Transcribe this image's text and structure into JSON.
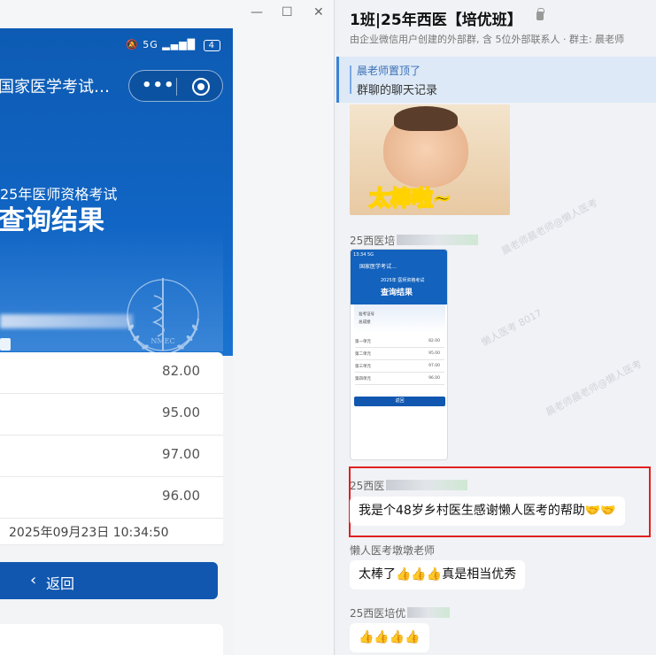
{
  "window": {
    "minimize_glyph": "—",
    "maximize_glyph": "☐",
    "close_glyph": "✕"
  },
  "phone": {
    "status_network": "5G",
    "status_signal": "▂▄▆█",
    "status_battery": "4",
    "app_title": "国家医学考试…",
    "hero_subtitle": "25年医师资格考试",
    "hero_title": "查询结果",
    "scores": [
      "82.00",
      "95.00",
      "97.00",
      "96.00"
    ],
    "query_time": "2025年09月23日 10:34:50",
    "back_label": "返回",
    "emblem_text": "NMEC"
  },
  "chat": {
    "title": "1班|25年西医【培优班】",
    "subtitle": "由企业微信用户创建的外部群, 含  5位外部联系人 · 群主: 晨老师",
    "pinned_by": "晨老师置顶了",
    "pinned_item": "群聊的聊天记录",
    "sticker_text": "太棒啦~",
    "messages": [
      {
        "sender": "25西医培"
      },
      {
        "sender": "25西医",
        "text": "我是个48岁乡村医生感谢懒人医考的帮助🤝🤝"
      },
      {
        "sender": "懒人医考墩墩老师",
        "text": "太棒了👍👍👍真是相当优秀"
      },
      {
        "sender": "25西医培优",
        "text": "👍👍👍👍"
      }
    ],
    "mini_screenshot": {
      "status": "13:34 5G",
      "app_title": "国家医学考试…",
      "subtitle": "2025年 医师资格考试",
      "title": "查询结果",
      "labels": [
        "准考证号",
        "总成绩",
        "第一单元",
        "第二单元",
        "第三单元",
        "第四单元"
      ],
      "scores": [
        "82.00",
        "95.00",
        "97.00",
        "96.00"
      ],
      "back": "返回"
    },
    "watermarks": [
      "晨老师晨老师@懒人医考",
      "懒人医考 8017",
      "晨老师晨老师@懒人医考"
    ]
  },
  "colors": {
    "hero_blue": "#0d5bb3",
    "button_blue": "#1157b0",
    "highlight_red": "#e02020",
    "pin_bg": "#dde9f7"
  }
}
